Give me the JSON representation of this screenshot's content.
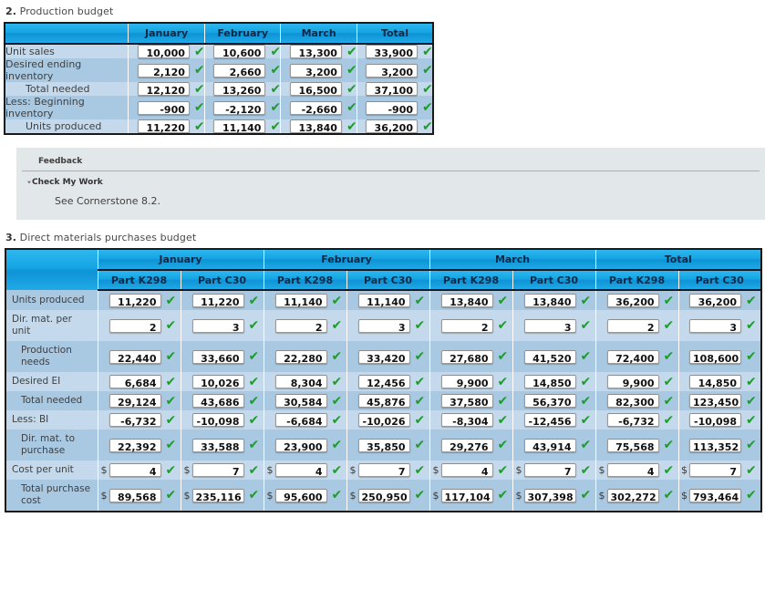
{
  "colors": {
    "header_blue": "#14a5e4",
    "row_light": "#c4daec",
    "row_dark": "#a9c8e2",
    "check_green": "#1d9c29",
    "feedback_bg": "#e2e8ea"
  },
  "section2": {
    "number": "2.",
    "title": "Production budget",
    "table": {
      "corner_label": "",
      "columns": [
        "January",
        "February",
        "March",
        "Total"
      ],
      "rows": [
        {
          "label": "Unit sales",
          "indent": false,
          "values": [
            "10,000",
            "10,600",
            "13,300",
            "33,900"
          ],
          "checks": [
            true,
            true,
            true,
            true
          ]
        },
        {
          "label": "Desired ending inventory",
          "indent": false,
          "values": [
            "2,120",
            "2,660",
            "3,200",
            "3,200"
          ],
          "checks": [
            true,
            true,
            true,
            true
          ]
        },
        {
          "label": "Total needed",
          "indent": true,
          "values": [
            "12,120",
            "13,260",
            "16,500",
            "37,100"
          ],
          "checks": [
            true,
            true,
            true,
            true
          ]
        },
        {
          "label": "Less: Beginning inventory",
          "indent": false,
          "values": [
            "-900",
            "-2,120",
            "-2,660",
            "-900"
          ],
          "checks": [
            true,
            true,
            true,
            true
          ]
        },
        {
          "label": "Units produced",
          "indent": true,
          "values": [
            "11,220",
            "11,140",
            "13,840",
            "36,200"
          ],
          "checks": [
            true,
            true,
            true,
            true
          ]
        }
      ]
    }
  },
  "feedback": {
    "title": "Feedback",
    "check_my_work_label": "Check My Work",
    "caret_glyph": "▾",
    "body": "See Cornerstone 8.2."
  },
  "section3": {
    "number": "3.",
    "title": "Direct materials purchases budget",
    "table": {
      "corner_label": "",
      "month_groups": [
        "January",
        "February",
        "March",
        "Total"
      ],
      "part_columns": [
        "Part K298",
        "Part C30"
      ],
      "rows": [
        {
          "label": "Units produced",
          "indent": false,
          "dollar": false,
          "values": [
            "11,220",
            "11,220",
            "11,140",
            "11,140",
            "13,840",
            "13,840",
            "36,200",
            "36,200"
          ],
          "checks": [
            true,
            true,
            true,
            true,
            true,
            true,
            true,
            true
          ]
        },
        {
          "label": "Dir. mat. per unit",
          "indent": false,
          "dollar": false,
          "values": [
            "2",
            "3",
            "2",
            "3",
            "2",
            "3",
            "2",
            "3"
          ],
          "checks": [
            true,
            true,
            true,
            true,
            true,
            true,
            true,
            true
          ]
        },
        {
          "label": "Production needs",
          "indent": true,
          "dollar": false,
          "values": [
            "22,440",
            "33,660",
            "22,280",
            "33,420",
            "27,680",
            "41,520",
            "72,400",
            "108,600"
          ],
          "checks": [
            true,
            true,
            true,
            true,
            true,
            true,
            true,
            true
          ]
        },
        {
          "label": "Desired EI",
          "indent": false,
          "dollar": false,
          "values": [
            "6,684",
            "10,026",
            "8,304",
            "12,456",
            "9,900",
            "14,850",
            "9,900",
            "14,850"
          ],
          "checks": [
            true,
            true,
            true,
            true,
            true,
            true,
            true,
            true
          ]
        },
        {
          "label": "Total needed",
          "indent": true,
          "dollar": false,
          "values": [
            "29,124",
            "43,686",
            "30,584",
            "45,876",
            "37,580",
            "56,370",
            "82,300",
            "123,450"
          ],
          "checks": [
            true,
            true,
            true,
            true,
            true,
            true,
            true,
            true
          ]
        },
        {
          "label": "Less: BI",
          "indent": false,
          "dollar": false,
          "values": [
            "-6,732",
            "-10,098",
            "-6,684",
            "-10,026",
            "-8,304",
            "-12,456",
            "-6,732",
            "-10,098"
          ],
          "checks": [
            true,
            true,
            true,
            true,
            true,
            true,
            true,
            true
          ]
        },
        {
          "label": "Dir. mat. to purchase",
          "indent": true,
          "dollar": false,
          "values": [
            "22,392",
            "33,588",
            "23,900",
            "35,850",
            "29,276",
            "43,914",
            "75,568",
            "113,352"
          ],
          "checks": [
            true,
            true,
            true,
            true,
            true,
            true,
            true,
            true
          ]
        },
        {
          "label": "Cost per unit",
          "indent": false,
          "dollar": true,
          "values": [
            "4",
            "7",
            "4",
            "7",
            "4",
            "7",
            "4",
            "7"
          ],
          "checks": [
            true,
            true,
            true,
            true,
            true,
            true,
            true,
            true
          ]
        },
        {
          "label": "Total purchase cost",
          "indent": true,
          "dollar": true,
          "values": [
            "89,568",
            "235,116",
            "95,600",
            "250,950",
            "117,104",
            "307,398",
            "302,272",
            "793,464"
          ],
          "checks": [
            true,
            true,
            true,
            true,
            true,
            true,
            true,
            true
          ]
        }
      ]
    }
  },
  "glyphs": {
    "check": "✔",
    "dollar": "$"
  }
}
